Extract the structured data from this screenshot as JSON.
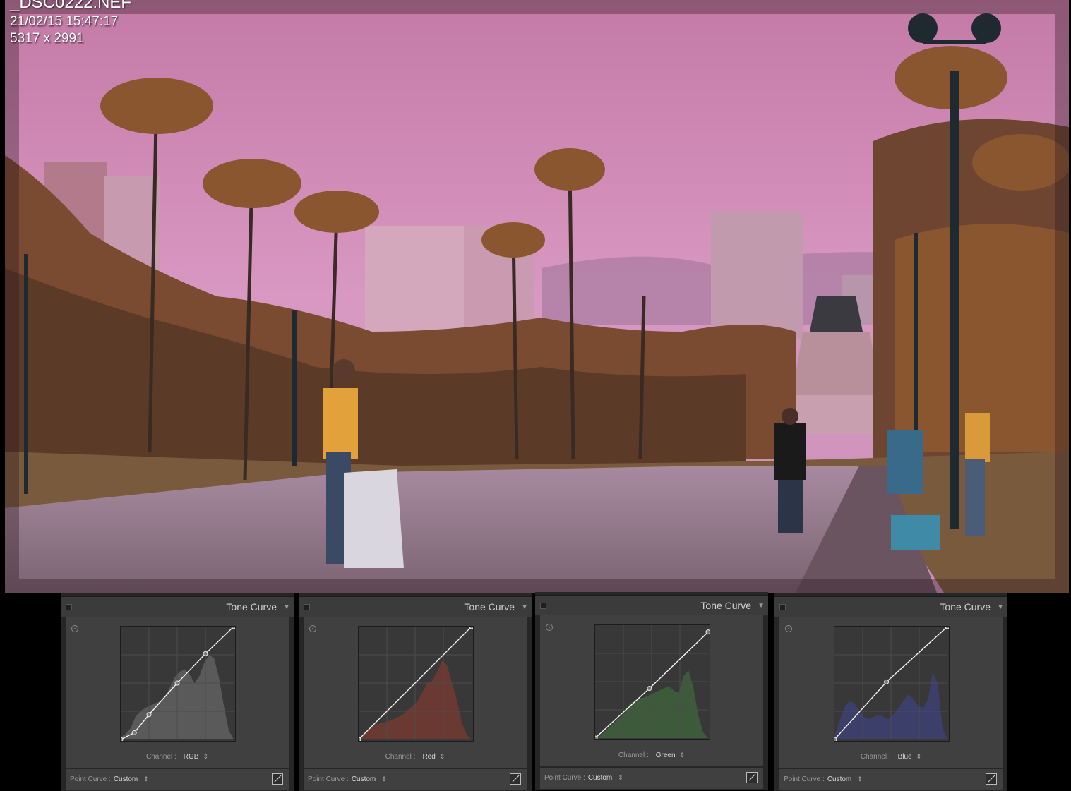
{
  "photo": {
    "filename": "_DSC0222.NEF",
    "datetime": "21/02/15 15:47:17",
    "dimensions": "5317 x 2991"
  },
  "panels": [
    {
      "title": "Tone Curve",
      "channel_label": "Channel :",
      "channel_value": "RGB",
      "point_curve_label": "Point Curve :",
      "point_curve_value": "Custom",
      "curve_color": "#ffffff",
      "hist_color": "#5a5a5a"
    },
    {
      "title": "Tone Curve",
      "channel_label": "Channel :",
      "channel_value": "Red",
      "point_curve_label": "Point Curve :",
      "point_curve_value": "Custom",
      "curve_color": "#ffffff",
      "hist_color": "#6a3a32"
    },
    {
      "title": "Tone Curve",
      "channel_label": "Channel :",
      "channel_value": "Green",
      "point_curve_label": "Point Curve :",
      "point_curve_value": "Custom",
      "curve_color": "#ffffff",
      "hist_color": "#3d5a3a"
    },
    {
      "title": "Tone Curve",
      "channel_label": "Channel :",
      "channel_value": "Blue",
      "point_curve_label": "Point Curve :",
      "point_curve_value": "Custom",
      "curve_color": "#ffffff",
      "hist_color": "#3b3f6a"
    }
  ]
}
